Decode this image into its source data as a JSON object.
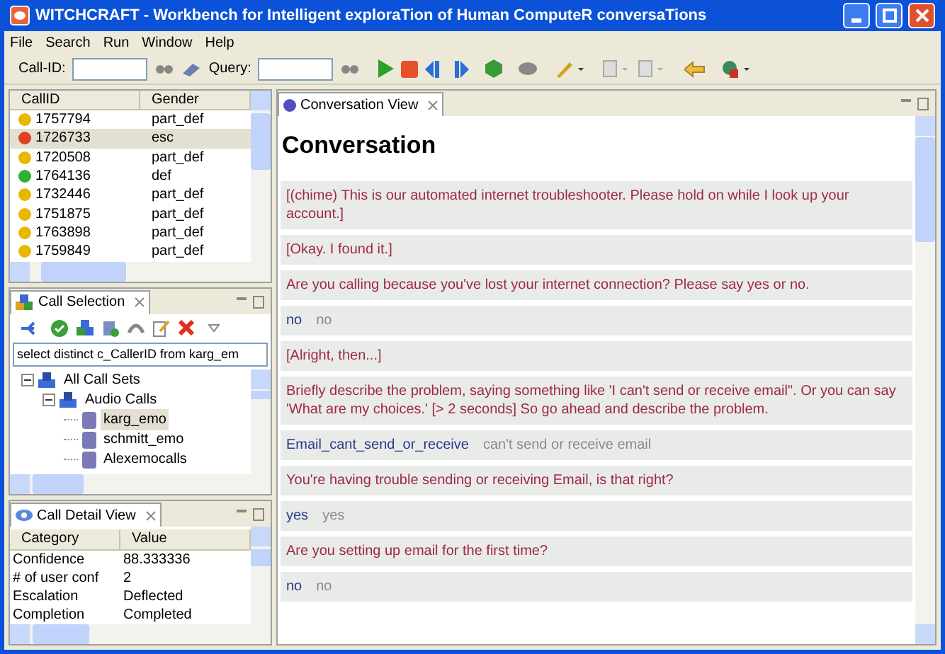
{
  "window": {
    "title": "WITCHCRAFT - Workbench for Intelligent exploraTion of Human ComputeR conversaTions"
  },
  "menu": [
    "File",
    "Search",
    "Run",
    "Window",
    "Help"
  ],
  "toolbar": {
    "callid_label": "Call-ID:",
    "query_label": "Query:"
  },
  "calls_table": {
    "columns": [
      "CallID",
      "Gender"
    ],
    "rows": [
      {
        "id": "1757794",
        "gender": "part_def",
        "color": "#e8b800",
        "selected": false
      },
      {
        "id": "1726733",
        "gender": "esc",
        "color": "#e04020",
        "selected": true
      },
      {
        "id": "1720508",
        "gender": "part_def",
        "color": "#e8b800",
        "selected": false
      },
      {
        "id": "1764136",
        "gender": "def",
        "color": "#30b030",
        "selected": false
      },
      {
        "id": "1732446",
        "gender": "part_def",
        "color": "#e8b800",
        "selected": false
      },
      {
        "id": "1751875",
        "gender": "part_def",
        "color": "#e8b800",
        "selected": false
      },
      {
        "id": "1763898",
        "gender": "part_def",
        "color": "#e8b800",
        "selected": false
      },
      {
        "id": "1759849",
        "gender": "part_def",
        "color": "#e8b800",
        "selected": false
      }
    ]
  },
  "call_selection": {
    "tab": "Call Selection",
    "query": "select distinct c_CallerID from karg_em",
    "tree": [
      {
        "label": "All Call Sets",
        "expanded": true,
        "selected": false,
        "children": [
          {
            "label": "Audio Calls",
            "expanded": true,
            "selected": false,
            "children": [
              {
                "label": "karg_emo",
                "selected": true
              },
              {
                "label": "schmitt_emo",
                "selected": false
              },
              {
                "label": "Alexemocalls",
                "selected": false
              }
            ]
          }
        ]
      }
    ]
  },
  "call_detail": {
    "tab": "Call Detail View",
    "columns": [
      "Category",
      "Value"
    ],
    "rows": [
      [
        "Confidence",
        "88.333336"
      ],
      [
        "# of user conf",
        "2"
      ],
      [
        "Escalation",
        "Deflected"
      ],
      [
        "Completion",
        "Completed"
      ]
    ]
  },
  "conversation": {
    "tab": "Conversation View",
    "heading": "Conversation",
    "turns": [
      {
        "kind": "prompt",
        "text": "[(chime) This is our automated internet troubleshooter. Please hold on while I look up your account.]"
      },
      {
        "kind": "prompt",
        "text": "[Okay. I found it.]"
      },
      {
        "kind": "prompt",
        "text": "Are you calling because you've lost your internet connection? Please say yes or no."
      },
      {
        "kind": "answer",
        "value": "no",
        "transcript": "no"
      },
      {
        "kind": "prompt",
        "text": "[Alright, then...]"
      },
      {
        "kind": "prompt",
        "text": "Briefly describe the problem, saying something like 'I can't send or receive email\". Or you can say 'What are my choices.' [> 2 seconds] So go ahead and describe the problem."
      },
      {
        "kind": "answer",
        "value": "Email_cant_send_or_receive",
        "transcript": "can't send or receive email"
      },
      {
        "kind": "prompt",
        "text": "You're having trouble sending or receiving Email, is that right?"
      },
      {
        "kind": "answer",
        "value": "yes",
        "transcript": "yes"
      },
      {
        "kind": "prompt",
        "text": "Are you setting up email for the first time?"
      },
      {
        "kind": "answer",
        "value": "no",
        "transcript": "no"
      }
    ]
  }
}
